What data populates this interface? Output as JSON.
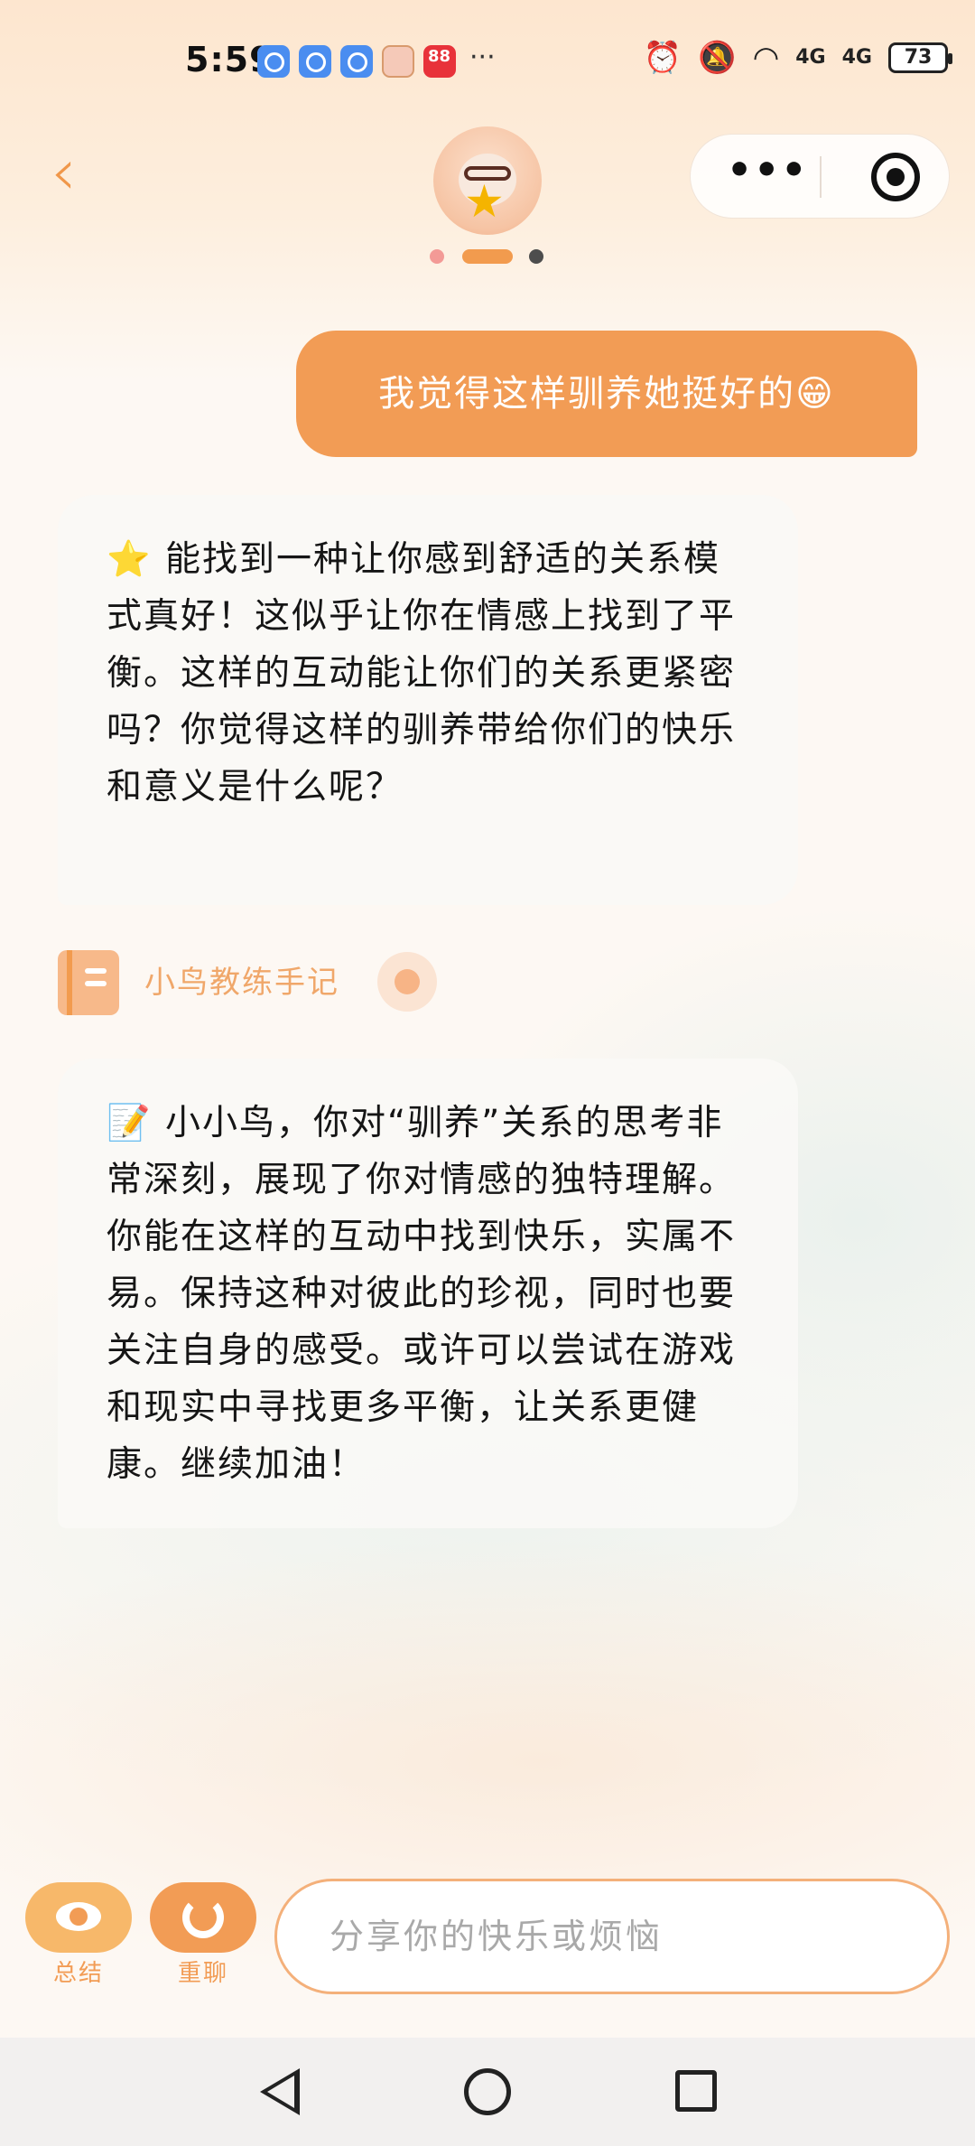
{
  "status_bar": {
    "time": "5:59",
    "more_indicator": "···",
    "signal_1": "4G",
    "signal_2": "4G",
    "battery": "73"
  },
  "header": {
    "back_icon": "chevron-left-icon",
    "avatar_icon": "coach-avatar",
    "capsule": {
      "more_label": "•••",
      "close_icon": "target-icon"
    }
  },
  "chat": {
    "messages": [
      {
        "role": "user",
        "text": "我觉得这样驯养她挺好的😁"
      },
      {
        "role": "bot",
        "text": "⭐ 能找到一种让你感到舒适的关系模式真好！这似乎让你在情感上找到了平衡。这样的互动能让你们的关系更紧密吗？你觉得这样的驯养带给你们的快乐和意义是什么呢？"
      },
      {
        "role": "bot",
        "text": "📝 小小鸟，你对“驯养”关系的思考非常深刻，展现了你对情感的独特理解。你能在这样的互动中找到快乐，实属不易。保持这种对彼此的珍视，同时也要关注自身的感受。或许可以尝试在游戏和现实中寻找更多平衡，让关系更健康。继续加油！"
      }
    ],
    "notebook_label": "小鸟教练手记"
  },
  "bottom": {
    "summary_label": "总结",
    "restart_label": "重聊",
    "input_placeholder": "分享你的快乐或烦恼"
  },
  "colors": {
    "accent": "#f29c55",
    "accent_light": "#f7b86a",
    "bubble_bg": "#faf8f6"
  }
}
